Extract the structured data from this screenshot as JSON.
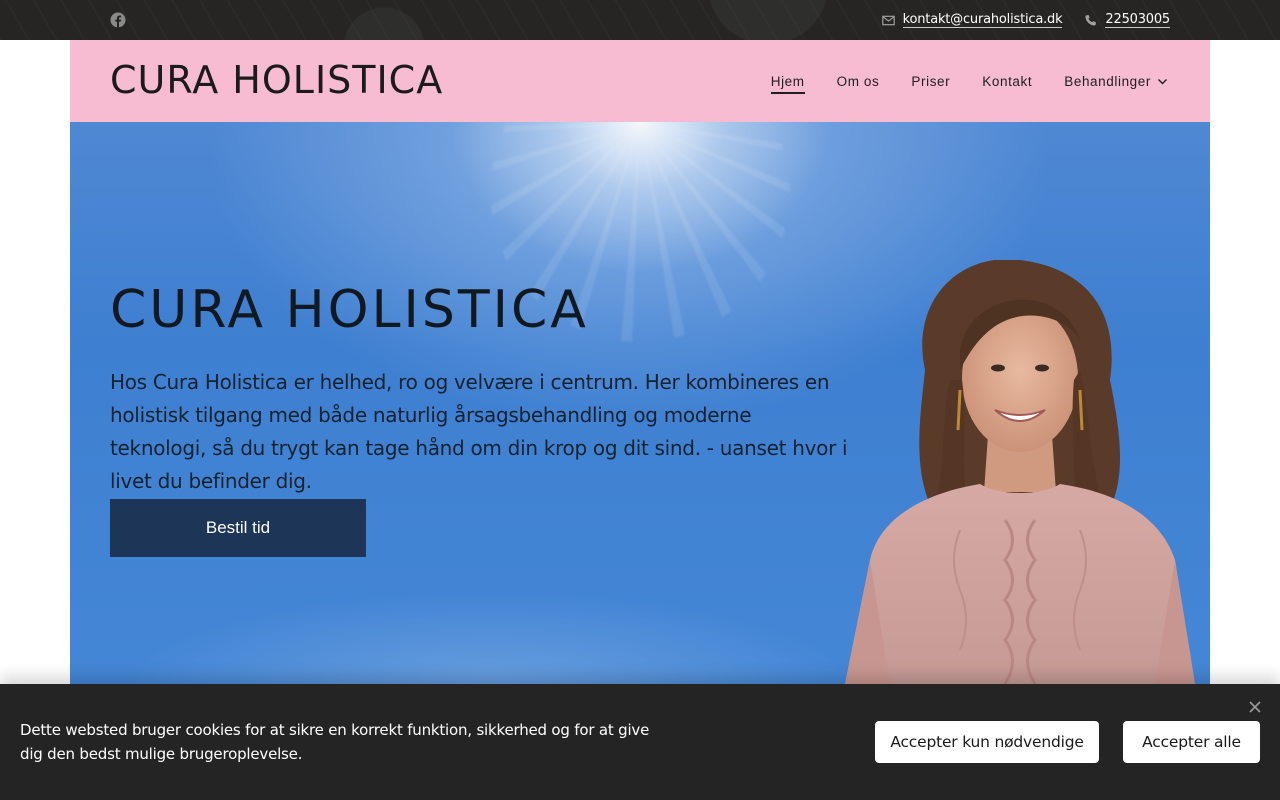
{
  "topbar": {
    "social_icon": "facebook-icon",
    "email_icon": "mail-icon",
    "email": "kontakt@curaholistica.dk",
    "phone_icon": "phone-icon",
    "phone": "22503005"
  },
  "header": {
    "logo": "CURA HOLISTICA",
    "nav": [
      {
        "label": "Hjem",
        "active": true
      },
      {
        "label": "Om os"
      },
      {
        "label": "Priser"
      },
      {
        "label": "Kontakt"
      },
      {
        "label": "Behandlinger",
        "icon": "chevron-down-icon"
      }
    ]
  },
  "hero": {
    "title": "CURA HOLISTICA",
    "text": "Hos Cura Holistica er helhed, ro og velvære i centrum. Her kombineres en holistisk tilgang med både naturlig årsagsbehandling og moderne teknologi, så du trygt kan tage hånd om din krop og dit sind. - uanset hvor i livet du befinder dig.",
    "cta": "Bestil tid"
  },
  "cookie": {
    "text": "Dette websted bruger cookies for at sikre en korrekt funktion, sikkerhed og for at give dig den bedst mulige brugeroplevelse.",
    "accept_necessary": "Accepter kun nødvendige",
    "accept_all": "Accepter alle",
    "close_icon": "close-icon"
  },
  "colors": {
    "topbar_bg": "#262524",
    "header_bg": "#f7bcd2",
    "hero_sky": "#3e7fd1",
    "cta_bg": "#1d3557",
    "cookie_bg": "#242424"
  }
}
